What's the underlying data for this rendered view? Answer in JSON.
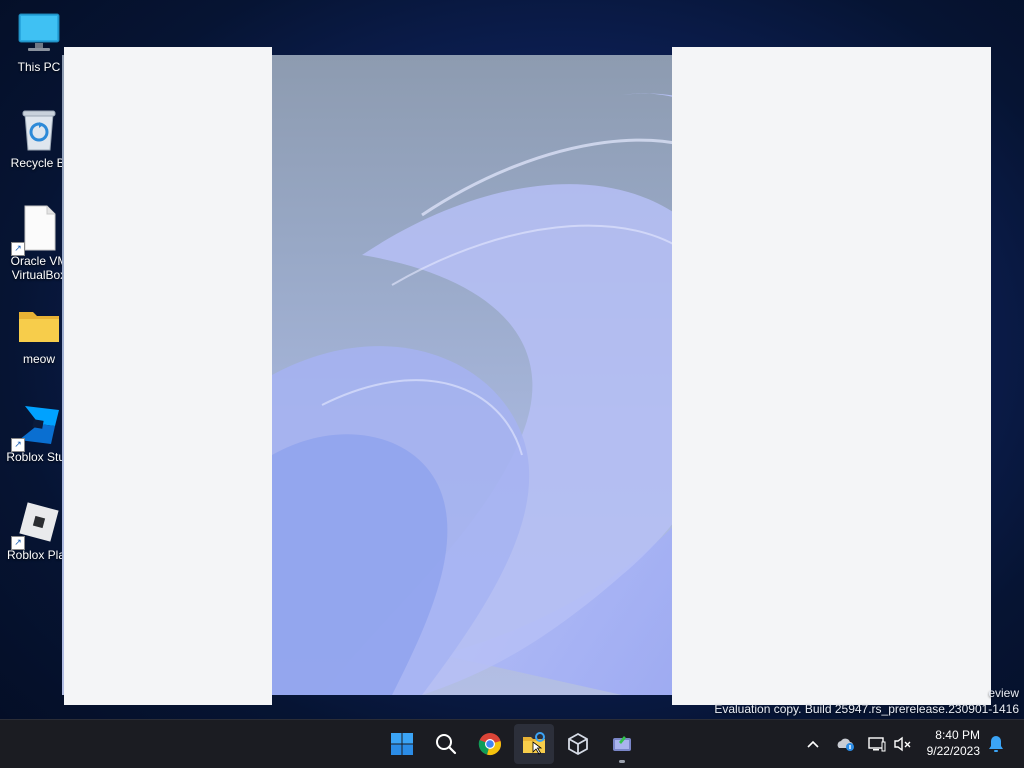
{
  "desktop": {
    "icons": [
      {
        "label": "This PC",
        "icon": "monitor-icon"
      },
      {
        "label": "Recycle Bi",
        "icon": "recycle-bin-icon"
      },
      {
        "label": "Oracle VM\nVirtualBox",
        "label_line1": "Oracle VM",
        "label_line2": "VirtualBox",
        "icon": "file-icon"
      },
      {
        "label": "meow",
        "icon": "folder-icon"
      },
      {
        "label": "Roblox Stud",
        "icon": "roblox-studio-icon"
      },
      {
        "label": "Roblox Play",
        "icon": "roblox-player-icon"
      }
    ]
  },
  "watermark": {
    "line1": "eview",
    "line2": "Evaluation copy. Build 25947.rs_prerelease.230901-1416"
  },
  "taskbar": {
    "apps": [
      {
        "name": "start",
        "icon": "windows-start-icon"
      },
      {
        "name": "search",
        "icon": "search-icon"
      },
      {
        "name": "chrome",
        "icon": "chrome-icon"
      },
      {
        "name": "file-explorer",
        "icon": "file-explorer-icon"
      },
      {
        "name": "virtualbox",
        "icon": "virtualbox-icon"
      },
      {
        "name": "app",
        "icon": "app-icon"
      }
    ],
    "tray": {
      "icons": [
        "chevron-up-icon",
        "onedrive-icon",
        "network-icon",
        "volume-muted-icon"
      ]
    },
    "clock": {
      "time": "8:40 PM",
      "date": "9/22/2023"
    }
  },
  "colors": {
    "taskbar": "#1b1c22",
    "window_panel": "#f4f5f7",
    "accent": "#0078d4"
  }
}
